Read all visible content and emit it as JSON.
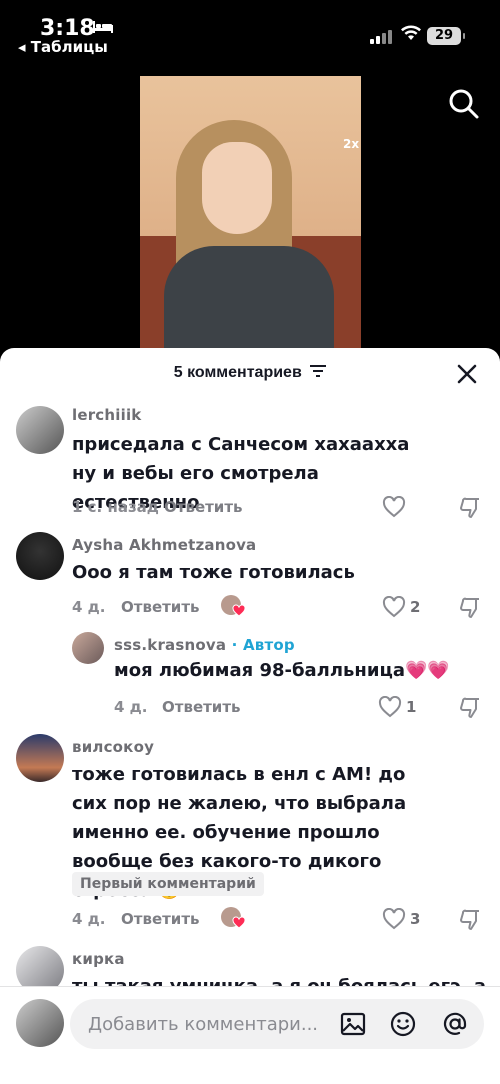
{
  "status": {
    "time": "3:18",
    "back_label": "◂ Таблицы",
    "battery": "29"
  },
  "video": {
    "speed": "2x"
  },
  "sheet": {
    "title": "5 комментариев"
  },
  "comments": [
    {
      "username": "lerchiiik",
      "text": "приседала с Санчесом хахааххa ну и вебы его смотрела естественно",
      "time": "1 с. назад",
      "reply": "Ответить",
      "likes": ""
    },
    {
      "username": "Aysha Akhmetzanova",
      "text": "Ооо я там тоже готовилась",
      "time": "4 д.",
      "reply": "Ответить",
      "likes": "2"
    },
    {
      "username": "sss.krasnova",
      "author_dot": "·",
      "author_label": "Автор",
      "text": "моя любимая 98-балльница💗💗",
      "time": "4 д.",
      "reply": "Ответить",
      "likes": "1"
    },
    {
      "username": "вилсокоу",
      "text": "тоже готовилась в енл с АМ! до сих пор не жалею, что выбрала именно ее. обучение прошло вообще без какого-то дикого стресса 🥹",
      "badge": "Первый комментарий",
      "time": "4 д.",
      "reply": "Ответить",
      "likes": "3"
    },
    {
      "username": "кирка",
      "text": "ты такая умничка, а я оч боялась егэ, а"
    }
  ],
  "composer": {
    "placeholder": "Добавить комментари..."
  },
  "icons": {
    "search": "search-icon",
    "close": "close-icon",
    "filter": "filter-icon",
    "like": "heart-icon",
    "dislike": "dislike-icon",
    "image": "image-icon",
    "emoji": "emoji-icon",
    "mention": "at-icon"
  },
  "colors": {
    "author": "#20a4d4",
    "creator_heart": "#fe2c55"
  }
}
